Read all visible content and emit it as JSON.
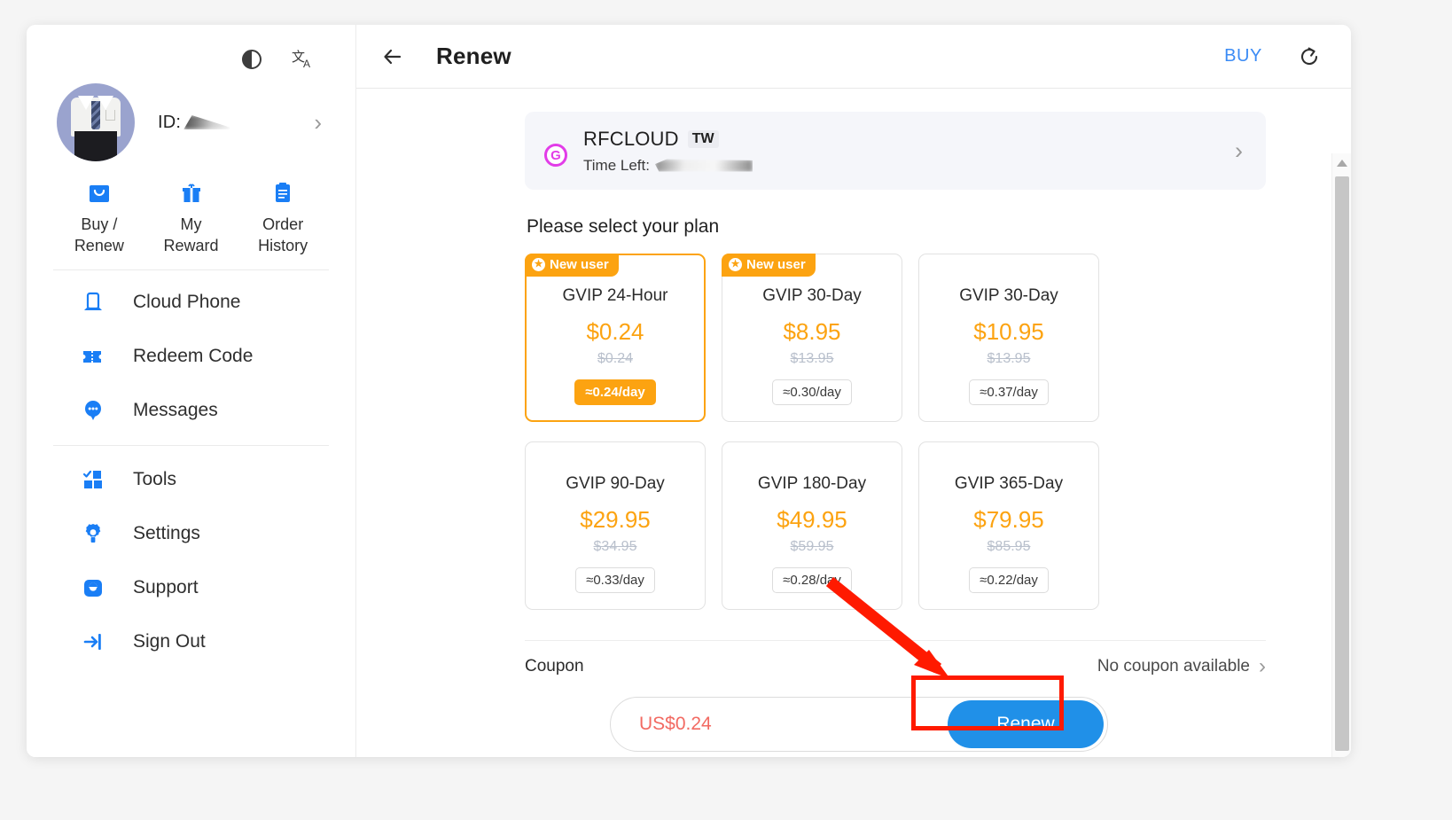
{
  "sidebar": {
    "utilities": [
      {
        "name": "theme-contrast-icon",
        "label": "Theme"
      },
      {
        "name": "language-icon",
        "label": "Language"
      }
    ],
    "profile": {
      "id_label": "ID:",
      "chevron": "›"
    },
    "quick_actions": [
      {
        "label_line1": "Buy /",
        "label_line2": "Renew",
        "icon": "shopping-bag-icon"
      },
      {
        "label_line1": "My",
        "label_line2": "Reward",
        "icon": "gift-icon"
      },
      {
        "label_line1": "Order",
        "label_line2": "History",
        "icon": "clipboard-list-icon"
      }
    ],
    "menu": [
      {
        "label": "Cloud Phone",
        "icon": "cloud-phone-icon"
      },
      {
        "label": "Redeem Code",
        "icon": "ticket-icon"
      },
      {
        "label": "Messages",
        "icon": "chat-bubble-icon"
      },
      {
        "label": "Tools",
        "icon": "grid-tools-icon"
      },
      {
        "label": "Settings",
        "icon": "gear-icon"
      },
      {
        "label": "Support",
        "icon": "headset-agent-icon"
      },
      {
        "label": "Sign Out",
        "icon": "sign-out-icon"
      }
    ]
  },
  "topbar": {
    "back_icon": "arrow-left-icon",
    "title": "Renew",
    "buy_label": "BUY",
    "refresh_icon": "refresh-icon"
  },
  "account_banner": {
    "badge": "G",
    "name": "RFCLOUD",
    "region": "TW",
    "time_left_label": "Time Left:",
    "chevron": "›"
  },
  "plans_section": {
    "heading": "Please select your plan",
    "new_user_badge": "New user",
    "star_glyph": "★",
    "plans": [
      {
        "name": "GVIP 24-Hour",
        "price": "$0.24",
        "old_price": "$0.24",
        "per_day": "≈0.24/day",
        "new_user": true,
        "selected": true
      },
      {
        "name": "GVIP 30-Day",
        "price": "$8.95",
        "old_price": "$13.95",
        "per_day": "≈0.30/day",
        "new_user": true,
        "selected": false
      },
      {
        "name": "GVIP 30-Day",
        "price": "$10.95",
        "old_price": "$13.95",
        "per_day": "≈0.37/day",
        "new_user": false,
        "selected": false
      },
      {
        "name": "GVIP 90-Day",
        "price": "$29.95",
        "old_price": "$34.95",
        "per_day": "≈0.33/day",
        "new_user": false,
        "selected": false
      },
      {
        "name": "GVIP 180-Day",
        "price": "$49.95",
        "old_price": "$59.95",
        "per_day": "≈0.28/day",
        "new_user": false,
        "selected": false
      },
      {
        "name": "GVIP 365-Day",
        "price": "$79.95",
        "old_price": "$85.95",
        "per_day": "≈0.22/day",
        "new_user": false,
        "selected": false
      }
    ]
  },
  "coupon": {
    "label": "Coupon",
    "status": "No coupon available",
    "chevron": "›"
  },
  "pay_bar": {
    "amount": "US$0.24",
    "renew_label": "Renew"
  },
  "scrollbar": {
    "up_arrow": "scroll-up-arrow",
    "down_arrow": "scroll-down-arrow"
  },
  "colors": {
    "accent_orange": "#fca311",
    "accent_blue": "#2090e8",
    "link_blue": "#3b8bf5",
    "price_red": "#f26a62",
    "annotation_red": "#ff1a00"
  }
}
